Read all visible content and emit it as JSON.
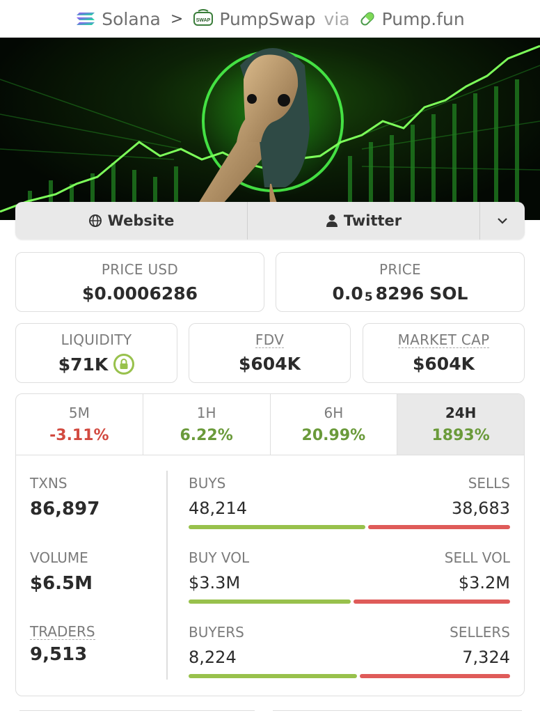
{
  "breadcrumb": {
    "chain": "Solana",
    "separator": ">",
    "dex": "PumpSwap",
    "via": "via",
    "launchpad": "Pump.fun"
  },
  "banner": {
    "alt_subject": "token-banner-image"
  },
  "links": {
    "website": "Website",
    "twitter": "Twitter"
  },
  "stats": {
    "price_usd": {
      "label": "PRICE USD",
      "value": "$0.0006286"
    },
    "price_native": {
      "label": "PRICE",
      "prefix": "0.0",
      "zeros": "5",
      "digits": "8296",
      "unit": "SOL"
    },
    "liquidity": {
      "label": "LIQUIDITY",
      "value": "$71K"
    },
    "fdv": {
      "label": "FDV",
      "value": "$604K"
    },
    "market_cap": {
      "label": "MARKET CAP",
      "value": "$604K"
    }
  },
  "timeframes": [
    {
      "label": "5M",
      "change": "-3.11%",
      "trend": "neg",
      "change_pct": -3.11
    },
    {
      "label": "1H",
      "change": "6.22%",
      "trend": "pos",
      "change_pct": 6.22
    },
    {
      "label": "6H",
      "change": "20.99%",
      "trend": "pos",
      "change_pct": 20.99
    },
    {
      "label": "24H",
      "change": "1893%",
      "trend": "pos",
      "change_pct": 1893,
      "selected": true
    }
  ],
  "metrics": {
    "txns": {
      "label": "TXNS",
      "value": "86,897"
    },
    "volume": {
      "label": "VOLUME",
      "value": "$6.5M"
    },
    "traders": {
      "label": "TRADERS",
      "value": "9,513"
    }
  },
  "splits": {
    "txns": {
      "left_label": "BUYS",
      "right_label": "SELLS",
      "left_value": "48,214",
      "right_value": "38,683",
      "buy_fraction": 0.555
    },
    "volume": {
      "left_label": "BUY VOL",
      "right_label": "SELL VOL",
      "left_value": "$3.3M",
      "right_value": "$3.2M",
      "buy_fraction": 0.508
    },
    "traders": {
      "left_label": "BUYERS",
      "right_label": "SELLERS",
      "left_value": "8,224",
      "right_value": "7,324",
      "buy_fraction": 0.529
    }
  },
  "colors": {
    "positive": "#6a9a3a",
    "negative": "#d24a40",
    "buy_bar": "#98c14c",
    "sell_bar": "#df5b59",
    "banner_glow": "#3cff3c"
  }
}
